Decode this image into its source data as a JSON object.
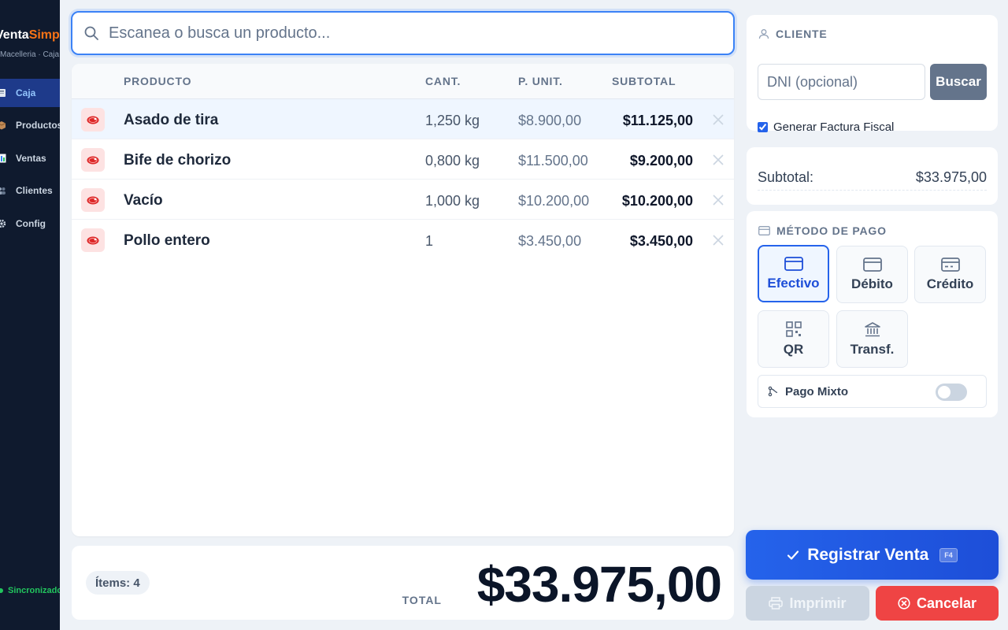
{
  "sidebar": {
    "brand_part1": "Venta",
    "brand_part2": "Simple",
    "brand_sub": "Macelleria · Caja",
    "items": [
      {
        "label": "Caja",
        "icon": "register-icon",
        "active": true
      },
      {
        "label": "Productos",
        "icon": "box-icon",
        "active": false
      },
      {
        "label": "Ventas",
        "icon": "chart-icon",
        "active": false
      },
      {
        "label": "Clientes",
        "icon": "users-icon",
        "active": false
      },
      {
        "label": "Config",
        "icon": "gear-icon",
        "active": false
      }
    ],
    "sync_status": "Sincronizado"
  },
  "search": {
    "placeholder": "Escanea o busca un producto..."
  },
  "table": {
    "headers": [
      "PRODUCTO",
      "CANT.",
      "P. UNIT.",
      "SUBTOTAL"
    ],
    "rows": [
      {
        "name": "Asado de tira",
        "qty": "1,250 kg",
        "unit": "$8.900,00",
        "subtotal": "$11.125,00"
      },
      {
        "name": "Bife de chorizo",
        "qty": "0,800 kg",
        "unit": "$11.500,00",
        "subtotal": "$9.200,00"
      },
      {
        "name": "Vacío",
        "qty": "1,000 kg",
        "unit": "$10.200,00",
        "subtotal": "$10.200,00"
      },
      {
        "name": "Pollo entero",
        "qty": "1",
        "unit": "$3.450,00",
        "subtotal": "$3.450,00"
      }
    ]
  },
  "totals": {
    "items_badge": "Ítems: 4",
    "total_label": "TOTAL",
    "total_value": "$33.975,00"
  },
  "client": {
    "title": "CLIENTE",
    "dni_placeholder": "DNI (opcional)",
    "search_button": "Buscar",
    "fiscal_label": "Generar Factura Fiscal",
    "fiscal_checked": true
  },
  "summary": {
    "subtotal_label": "Subtotal:",
    "subtotal_value": "$33.975,00"
  },
  "payment": {
    "title": "MÉTODO DE PAGO",
    "methods": [
      {
        "label": "Efectivo",
        "icon": "cash-icon",
        "active": true
      },
      {
        "label": "Débito",
        "icon": "debit-card-icon",
        "active": false
      },
      {
        "label": "Crédito",
        "icon": "credit-card-icon",
        "active": false
      },
      {
        "label": "QR",
        "icon": "qr-icon",
        "active": false
      },
      {
        "label": "Transf.",
        "icon": "bank-icon",
        "active": false
      }
    ],
    "mixed_label": "Pago Mixto",
    "mixed_enabled": false
  },
  "actions": {
    "register_label": "Registrar Venta",
    "register_shortcut": "F4",
    "print_label": "Imprimir",
    "cancel_label": "Cancelar"
  },
  "colors": {
    "accent": "#2563eb",
    "sidebar_bg": "#0f1a2e",
    "brand_accent": "#f97316",
    "danger": "#ef4444",
    "success": "#22c55e"
  }
}
